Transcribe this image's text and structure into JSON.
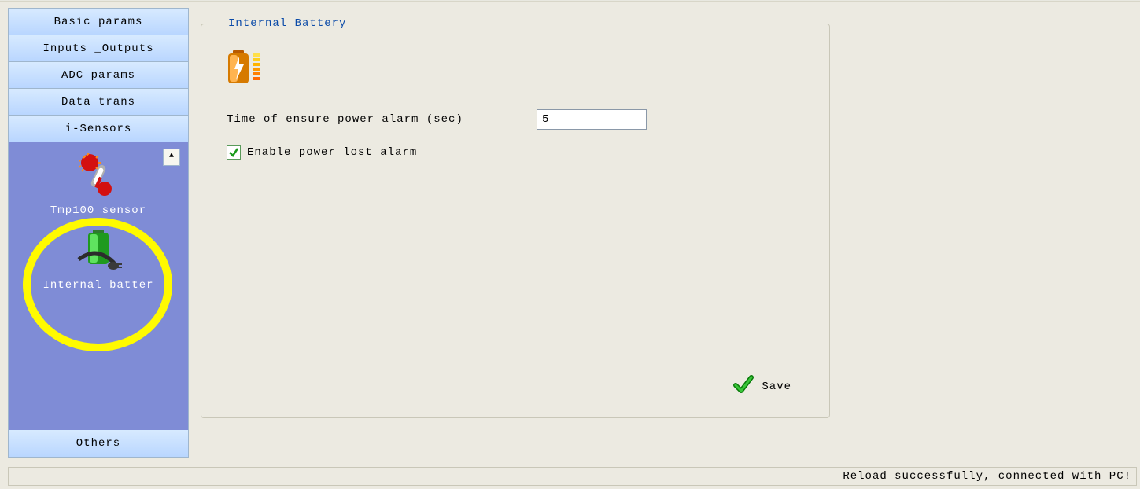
{
  "sidebar": {
    "headers": [
      "Basic params",
      "Inputs _Outputs",
      "ADC params",
      "Data trans",
      "i-Sensors"
    ],
    "footer": "Others",
    "items": [
      {
        "label": "Tmp100 sensor"
      },
      {
        "label": "Internal batter"
      }
    ]
  },
  "panel": {
    "title": "Internal Battery",
    "time_label": "Time of ensure power alarm (sec)",
    "time_value": "5",
    "enable_label": "Enable power lost alarm",
    "enable_checked": true,
    "save_label": "Save"
  },
  "status": "Reload successfully, connected with PC!"
}
